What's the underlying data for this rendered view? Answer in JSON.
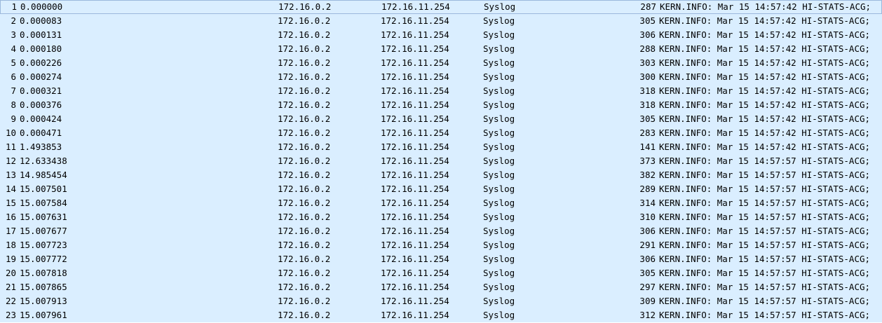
{
  "colors": {
    "row_background": "#daeeff",
    "selected_border": "#9bb8dc",
    "text": "#000000"
  },
  "packets": [
    {
      "no": "1",
      "time": "0.000000",
      "source": "172.16.0.2",
      "destination": "172.16.11.254",
      "protocol": "Syslog",
      "length": "287",
      "info": "KERN.INFO: Mar 15 14:57:42 HI-STATS-ACG;"
    },
    {
      "no": "2",
      "time": "0.000083",
      "source": "172.16.0.2",
      "destination": "172.16.11.254",
      "protocol": "Syslog",
      "length": "305",
      "info": "KERN.INFO: Mar 15 14:57:42 HI-STATS-ACG;"
    },
    {
      "no": "3",
      "time": "0.000131",
      "source": "172.16.0.2",
      "destination": "172.16.11.254",
      "protocol": "Syslog",
      "length": "306",
      "info": "KERN.INFO: Mar 15 14:57:42 HI-STATS-ACG;"
    },
    {
      "no": "4",
      "time": "0.000180",
      "source": "172.16.0.2",
      "destination": "172.16.11.254",
      "protocol": "Syslog",
      "length": "288",
      "info": "KERN.INFO: Mar 15 14:57:42 HI-STATS-ACG;"
    },
    {
      "no": "5",
      "time": "0.000226",
      "source": "172.16.0.2",
      "destination": "172.16.11.254",
      "protocol": "Syslog",
      "length": "303",
      "info": "KERN.INFO: Mar 15 14:57:42 HI-STATS-ACG;"
    },
    {
      "no": "6",
      "time": "0.000274",
      "source": "172.16.0.2",
      "destination": "172.16.11.254",
      "protocol": "Syslog",
      "length": "300",
      "info": "KERN.INFO: Mar 15 14:57:42 HI-STATS-ACG;"
    },
    {
      "no": "7",
      "time": "0.000321",
      "source": "172.16.0.2",
      "destination": "172.16.11.254",
      "protocol": "Syslog",
      "length": "318",
      "info": "KERN.INFO: Mar 15 14:57:42 HI-STATS-ACG;"
    },
    {
      "no": "8",
      "time": "0.000376",
      "source": "172.16.0.2",
      "destination": "172.16.11.254",
      "protocol": "Syslog",
      "length": "318",
      "info": "KERN.INFO: Mar 15 14:57:42 HI-STATS-ACG;"
    },
    {
      "no": "9",
      "time": "0.000424",
      "source": "172.16.0.2",
      "destination": "172.16.11.254",
      "protocol": "Syslog",
      "length": "305",
      "info": "KERN.INFO: Mar 15 14:57:42 HI-STATS-ACG;"
    },
    {
      "no": "10",
      "time": "0.000471",
      "source": "172.16.0.2",
      "destination": "172.16.11.254",
      "protocol": "Syslog",
      "length": "283",
      "info": "KERN.INFO: Mar 15 14:57:42 HI-STATS-ACG;"
    },
    {
      "no": "11",
      "time": "1.493853",
      "source": "172.16.0.2",
      "destination": "172.16.11.254",
      "protocol": "Syslog",
      "length": "141",
      "info": "KERN.INFO: Mar 15 14:57:42 HI-STATS-ACG;"
    },
    {
      "no": "12",
      "time": "12.633438",
      "source": "172.16.0.2",
      "destination": "172.16.11.254",
      "protocol": "Syslog",
      "length": "373",
      "info": "KERN.INFO: Mar 15 14:57:57 HI-STATS-ACG;"
    },
    {
      "no": "13",
      "time": "14.985454",
      "source": "172.16.0.2",
      "destination": "172.16.11.254",
      "protocol": "Syslog",
      "length": "382",
      "info": "KERN.INFO: Mar 15 14:57:57 HI-STATS-ACG;"
    },
    {
      "no": "14",
      "time": "15.007501",
      "source": "172.16.0.2",
      "destination": "172.16.11.254",
      "protocol": "Syslog",
      "length": "289",
      "info": "KERN.INFO: Mar 15 14:57:57 HI-STATS-ACG;"
    },
    {
      "no": "15",
      "time": "15.007584",
      "source": "172.16.0.2",
      "destination": "172.16.11.254",
      "protocol": "Syslog",
      "length": "314",
      "info": "KERN.INFO: Mar 15 14:57:57 HI-STATS-ACG;"
    },
    {
      "no": "16",
      "time": "15.007631",
      "source": "172.16.0.2",
      "destination": "172.16.11.254",
      "protocol": "Syslog",
      "length": "310",
      "info": "KERN.INFO: Mar 15 14:57:57 HI-STATS-ACG;"
    },
    {
      "no": "17",
      "time": "15.007677",
      "source": "172.16.0.2",
      "destination": "172.16.11.254",
      "protocol": "Syslog",
      "length": "306",
      "info": "KERN.INFO: Mar 15 14:57:57 HI-STATS-ACG;"
    },
    {
      "no": "18",
      "time": "15.007723",
      "source": "172.16.0.2",
      "destination": "172.16.11.254",
      "protocol": "Syslog",
      "length": "291",
      "info": "KERN.INFO: Mar 15 14:57:57 HI-STATS-ACG;"
    },
    {
      "no": "19",
      "time": "15.007772",
      "source": "172.16.0.2",
      "destination": "172.16.11.254",
      "protocol": "Syslog",
      "length": "306",
      "info": "KERN.INFO: Mar 15 14:57:57 HI-STATS-ACG;"
    },
    {
      "no": "20",
      "time": "15.007818",
      "source": "172.16.0.2",
      "destination": "172.16.11.254",
      "protocol": "Syslog",
      "length": "305",
      "info": "KERN.INFO: Mar 15 14:57:57 HI-STATS-ACG;"
    },
    {
      "no": "21",
      "time": "15.007865",
      "source": "172.16.0.2",
      "destination": "172.16.11.254",
      "protocol": "Syslog",
      "length": "297",
      "info": "KERN.INFO: Mar 15 14:57:57 HI-STATS-ACG;"
    },
    {
      "no": "22",
      "time": "15.007913",
      "source": "172.16.0.2",
      "destination": "172.16.11.254",
      "protocol": "Syslog",
      "length": "309",
      "info": "KERN.INFO: Mar 15 14:57:57 HI-STATS-ACG;"
    },
    {
      "no": "23",
      "time": "15.007961",
      "source": "172.16.0.2",
      "destination": "172.16.11.254",
      "protocol": "Syslog",
      "length": "312",
      "info": "KERN.INFO: Mar 15 14:57:57 HI-STATS-ACG;"
    }
  ]
}
